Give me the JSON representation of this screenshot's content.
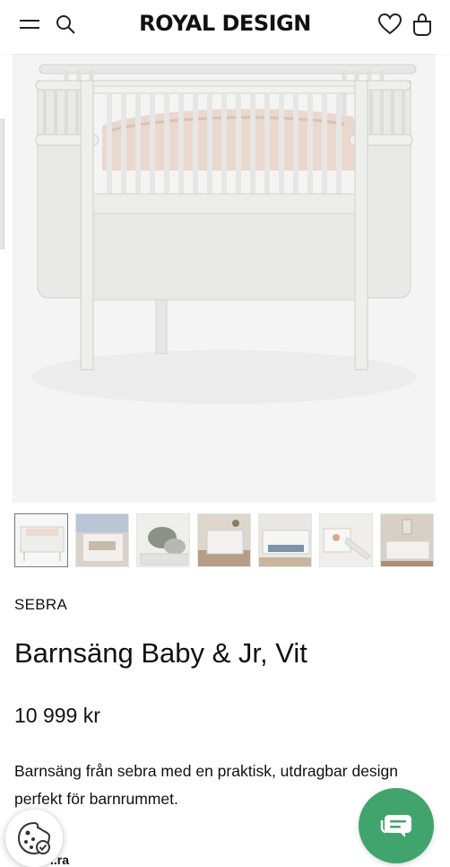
{
  "header": {
    "logo": "ROYAL DESIGN",
    "icons": [
      "menu-icon",
      "search-icon",
      "heart-icon",
      "bag-icon"
    ]
  },
  "gallery": {
    "hero_image": "white crib product photo",
    "thumbnails": [
      "crib-front",
      "crib-detail",
      "crib-with-pillows",
      "nursery-room",
      "crib-extended",
      "crib-slide",
      "nursery-corner"
    ],
    "selected_index": 0
  },
  "product": {
    "brand": "SEBRA",
    "title": "Barnsäng Baby & Jr, Vit",
    "price": "10 999 kr",
    "description": "Barnsäng från sebra med en praktisk, utdragbar design perfekt för barnrummet.",
    "cut_off_text": "..ra"
  },
  "floating": {
    "cookie_icon": "cookie-icon",
    "chat_icon": "chat-bubbles-icon",
    "chat_color": "#41a46d"
  }
}
